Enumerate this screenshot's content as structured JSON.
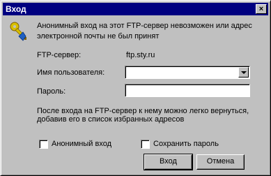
{
  "window": {
    "title": "Вход",
    "close_glyph": "×"
  },
  "message": {
    "line1": "Анонимный вход на этот FTP-сервер невозможен или адрес",
    "line2": "электронной почты не был принят"
  },
  "form": {
    "server_label": "FTP-сервер:",
    "server_value": "ftp.sty.ru",
    "username_label": "Имя пользователя:",
    "username_value": "",
    "password_label": "Пароль:",
    "password_value": ""
  },
  "note": {
    "line1": "После входа на FTP-сервер к нему можно легко вернуться,",
    "line2": "добавив его в список избранных адресов"
  },
  "options": {
    "anonymous_label": "Анонимный вход",
    "anonymous_checked": false,
    "save_password_label": "Сохранить пароль",
    "save_password_checked": false
  },
  "buttons": {
    "login": "Вход",
    "cancel": "Отмена"
  },
  "icons": {
    "login_icon": "key-icon",
    "dropdown_icon": "chevron-down-icon"
  },
  "colors": {
    "titlebar": "#000080",
    "dialog_bg": "#c0c0c0"
  }
}
